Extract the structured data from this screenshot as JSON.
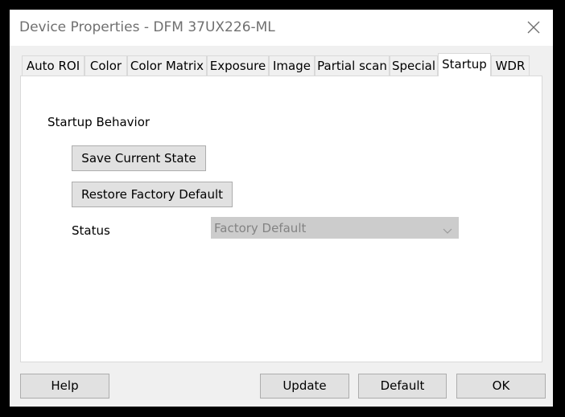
{
  "window": {
    "title": "Device Properties - DFM 37UX226-ML"
  },
  "tabs": [
    {
      "label": "Auto ROI"
    },
    {
      "label": "Color"
    },
    {
      "label": "Color Matrix"
    },
    {
      "label": "Exposure"
    },
    {
      "label": "Image"
    },
    {
      "label": "Partial scan"
    },
    {
      "label": "Special"
    },
    {
      "label": "Startup",
      "active": true
    },
    {
      "label": "WDR"
    }
  ],
  "startup": {
    "section_label": "Startup Behavior",
    "save_label": "Save Current State",
    "restore_label": "Restore Factory Default",
    "status_label": "Status",
    "status_value": "Factory Default"
  },
  "footer": {
    "help_label": "Help",
    "update_label": "Update",
    "default_label": "Default",
    "ok_label": "OK"
  },
  "icons": {
    "close": "close-icon",
    "dropdown": "chevron-down-icon"
  }
}
